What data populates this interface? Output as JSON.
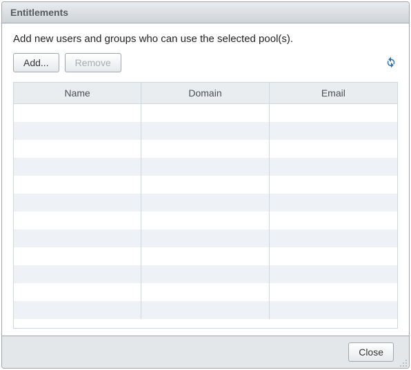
{
  "dialog": {
    "title": "Entitlements",
    "instruction": "Add new users and groups who can use the selected pool(s).",
    "buttons": {
      "add_label": "Add...",
      "remove_label": "Remove",
      "remove_enabled": false,
      "close_label": "Close"
    },
    "grid": {
      "columns": [
        "Name",
        "Domain",
        "Email"
      ],
      "rows": [],
      "visible_row_count": 12
    }
  }
}
